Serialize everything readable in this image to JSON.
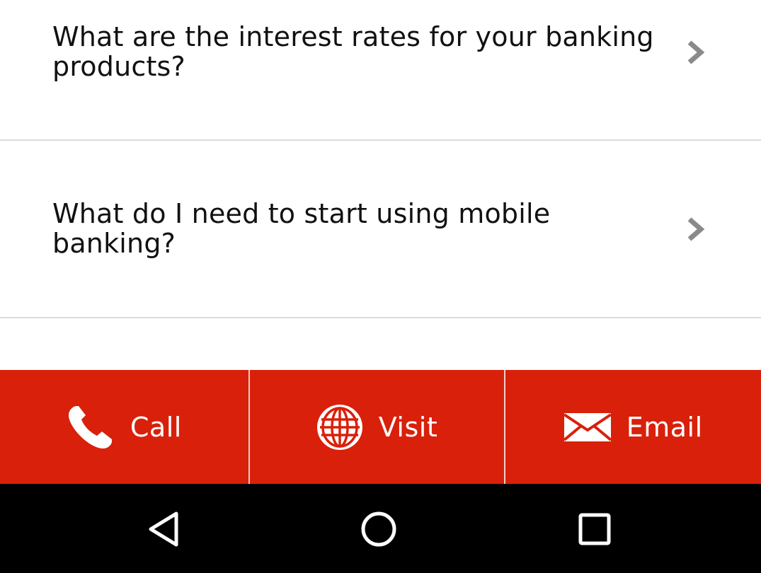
{
  "faq": {
    "items": [
      {
        "question": "What are the interest rates for your banking products?"
      },
      {
        "question": "What do I need to start using mobile banking?"
      }
    ]
  },
  "actions": {
    "call_label": "Call",
    "visit_label": "Visit",
    "email_label": "Email",
    "background_color": "#d9200a"
  },
  "nav": {
    "icons": [
      "back-icon",
      "home-icon",
      "recent-apps-icon"
    ]
  }
}
